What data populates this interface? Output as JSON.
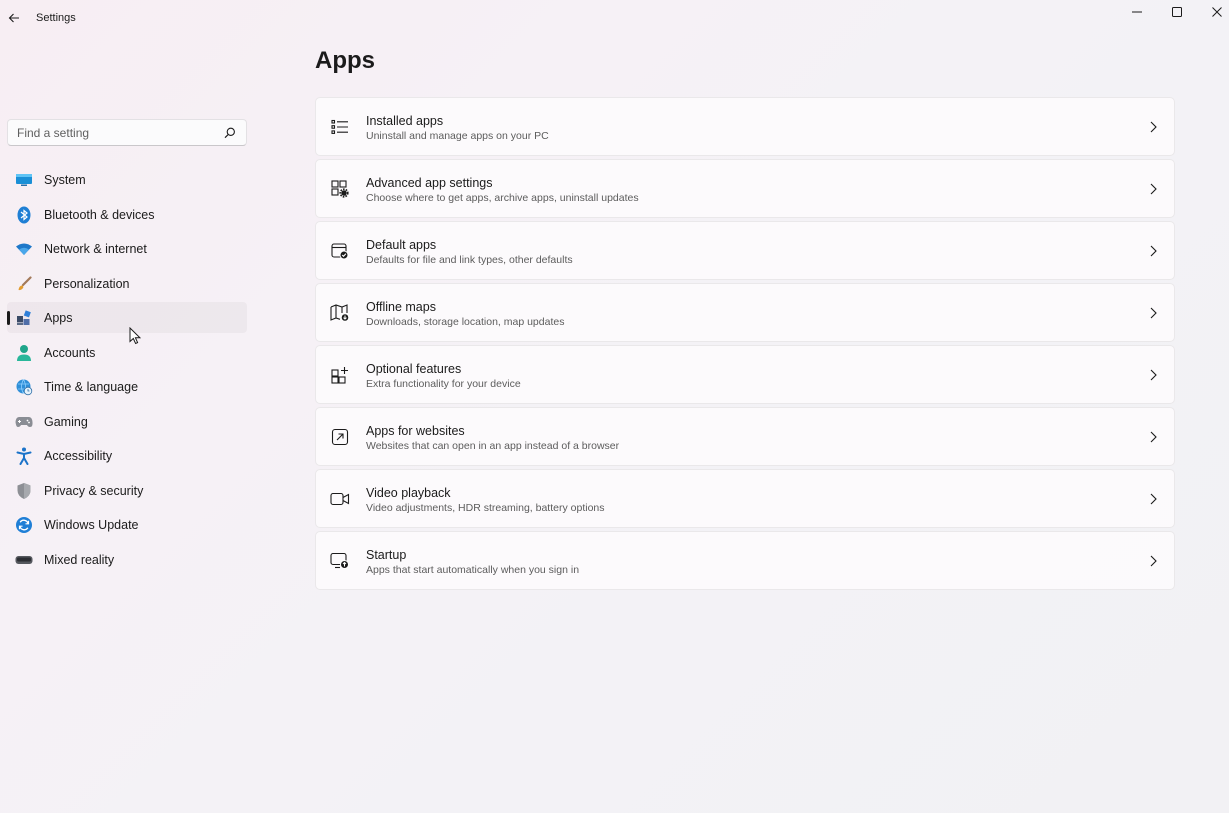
{
  "window": {
    "title": "Settings",
    "controls": [
      "minimize",
      "maximize",
      "close"
    ]
  },
  "search": {
    "placeholder": "Find a setting"
  },
  "sidebar": {
    "items": [
      {
        "label": "System",
        "icon": "system-icon"
      },
      {
        "label": "Bluetooth & devices",
        "icon": "bluetooth-icon"
      },
      {
        "label": "Network & internet",
        "icon": "wifi-icon"
      },
      {
        "label": "Personalization",
        "icon": "brush-icon"
      },
      {
        "label": "Apps",
        "icon": "apps-icon",
        "active": true
      },
      {
        "label": "Accounts",
        "icon": "person-icon"
      },
      {
        "label": "Time & language",
        "icon": "globe-clock-icon"
      },
      {
        "label": "Gaming",
        "icon": "gamepad-icon"
      },
      {
        "label": "Accessibility",
        "icon": "accessibility-icon"
      },
      {
        "label": "Privacy & security",
        "icon": "shield-icon"
      },
      {
        "label": "Windows Update",
        "icon": "update-icon"
      },
      {
        "label": "Mixed reality",
        "icon": "vr-headset-icon"
      }
    ]
  },
  "main": {
    "title": "Apps",
    "cards": [
      {
        "title": "Installed apps",
        "subtitle": "Uninstall and manage apps on your PC",
        "icon": "list-icon"
      },
      {
        "title": "Advanced app settings",
        "subtitle": "Choose where to get apps, archive apps, uninstall updates",
        "icon": "app-settings-icon"
      },
      {
        "title": "Default apps",
        "subtitle": "Defaults for file and link types, other defaults",
        "icon": "default-apps-icon"
      },
      {
        "title": "Offline maps",
        "subtitle": "Downloads, storage location, map updates",
        "icon": "map-download-icon"
      },
      {
        "title": "Optional features",
        "subtitle": "Extra functionality for your device",
        "icon": "add-grid-icon"
      },
      {
        "title": "Apps for websites",
        "subtitle": "Websites that can open in an app instead of a browser",
        "icon": "open-external-icon"
      },
      {
        "title": "Video playback",
        "subtitle": "Video adjustments, HDR streaming, battery options",
        "icon": "video-icon"
      },
      {
        "title": "Startup",
        "subtitle": "Apps that start automatically when you sign in",
        "icon": "startup-icon"
      }
    ]
  },
  "colors": {
    "accent": "#0067c0",
    "text": "#1b1b1b",
    "subtext": "#5c5c5c"
  }
}
